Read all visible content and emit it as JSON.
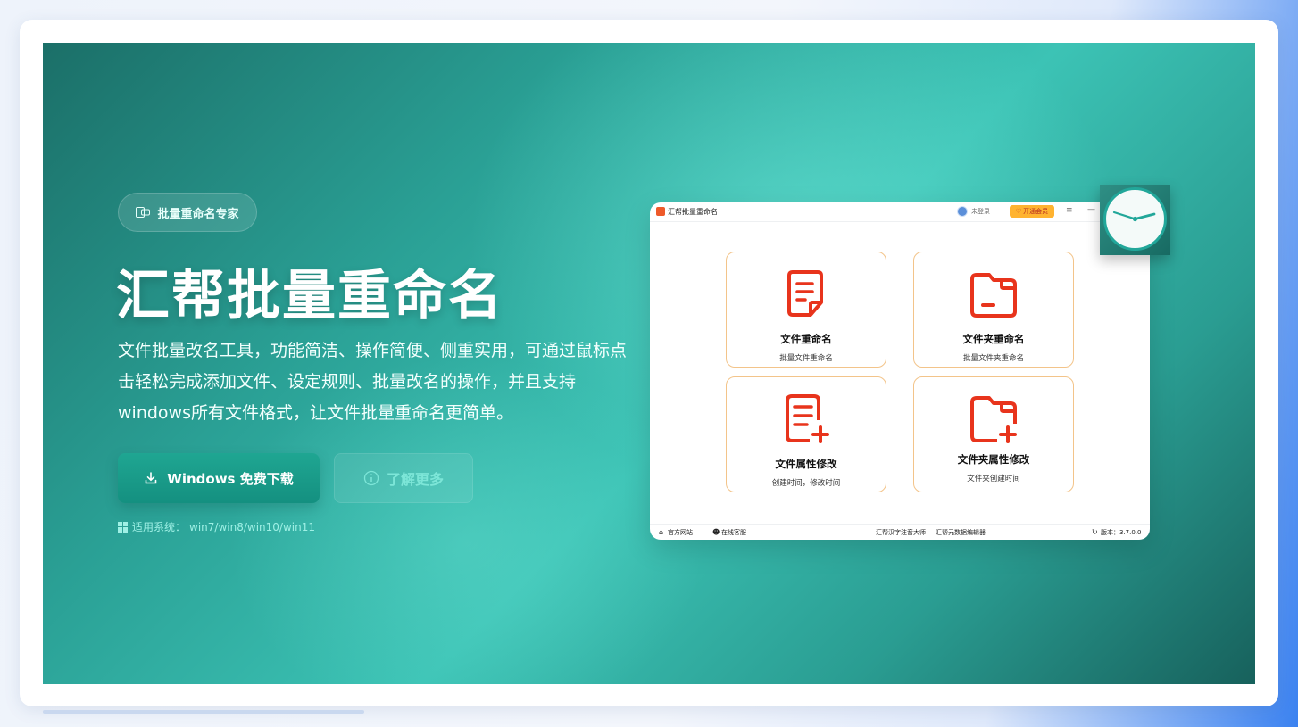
{
  "badge": {
    "label": "批量重命名专家",
    "icon": "translate-icon"
  },
  "hero": {
    "title": "汇帮批量重命名",
    "description": "文件批量改名工具，功能简洁、操作简便、侧重实用，可通过鼠标点击轻松完成添加文件、设定规则、批量改名的操作，并且支持windows所有文件格式，让文件批量重命名更简单。",
    "download_label": "Windows 免费下载",
    "learn_more_label": "了解更多",
    "compat_prefix": "适用系统：",
    "compat_systems": "win7/win8/win10/win11"
  },
  "app": {
    "title": "汇帮批量重命名",
    "login_label": "未登录",
    "vip_label": "开通会员",
    "menu_glyph": "≡",
    "min_glyph": "—",
    "features": [
      {
        "name": "文件重命名",
        "desc": "批量文件重命名",
        "icon": "document-icon"
      },
      {
        "name": "文件夹重命名",
        "desc": "批量文件夹重命名",
        "icon": "folder-icon"
      },
      {
        "name": "文件属性修改",
        "desc": "创建时间，修改时间",
        "icon": "document-add-icon"
      },
      {
        "name": "文件夹属性修改",
        "desc": "文件夹创建时间",
        "icon": "folder-add-icon"
      }
    ],
    "footer": {
      "website": "官方网站",
      "service": "在线客服",
      "pinyin_tool": "汇帮汉字注音大师",
      "metadata_tool": "汇帮元数据编辑器",
      "version_label": "版本：3.7.0.0"
    }
  },
  "colors": {
    "accent_teal": "#149080",
    "icon_red": "#e8341c",
    "card_border": "#f3c48a",
    "vip_orange": "#ffb330"
  }
}
